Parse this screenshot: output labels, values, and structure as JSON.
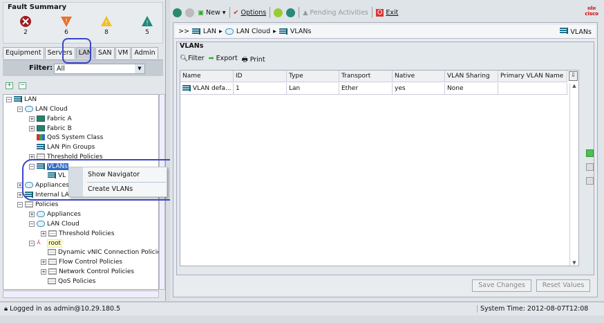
{
  "fault_summary": {
    "title": "Fault Summary",
    "counts": [
      {
        "icon": "critical-icon",
        "count": "2"
      },
      {
        "icon": "major-icon",
        "count": "6"
      },
      {
        "icon": "minor-icon",
        "count": "8"
      },
      {
        "icon": "warning-icon",
        "count": "5"
      }
    ]
  },
  "nav_tabs": [
    "Equipment",
    "Servers",
    "LAN",
    "SAN",
    "VM",
    "Admin"
  ],
  "filter": {
    "label": "Filter:",
    "value": "All"
  },
  "tree": [
    "LAN",
    "LAN Cloud",
    "Fabric A",
    "Fabric B",
    "QoS System Class",
    "LAN Pin Groups",
    "Threshold Policies",
    "VLANs",
    "VL",
    "Appliances",
    "Internal LA",
    "Policies",
    "Appliances",
    "LAN Cloud",
    "Threshold Policies",
    "root",
    "Dynamic vNIC Connection Policies",
    "Flow Control Policies",
    "Network Control Policies",
    "QoS Policies"
  ],
  "context_menu": [
    "Show Navigator",
    "Create VLANs"
  ],
  "toolbar": {
    "new": "New",
    "options": "Options",
    "pending": "Pending Activities",
    "exit": "Exit",
    "logo": "cisco"
  },
  "breadcrumb": {
    "prefix": ">>",
    "items": [
      "LAN",
      "LAN Cloud",
      "VLANs"
    ],
    "right": "VLANs"
  },
  "panel": {
    "title": "VLANs",
    "filter": "Filter",
    "export": "Export",
    "print": "Print"
  },
  "table": {
    "columns": [
      "Name",
      "ID",
      "Type",
      "Transport",
      "Native",
      "VLAN Sharing",
      "Primary VLAN Name"
    ],
    "rows": [
      [
        "VLAN defa...",
        "1",
        "Lan",
        "Ether",
        "yes",
        "None",
        ""
      ]
    ]
  },
  "buttons": {
    "save": "Save Changes",
    "reset": "Reset Values"
  },
  "status": {
    "login": "Logged in as admin@10.29.180.5",
    "time": "System Time: 2012-08-07T12:08"
  }
}
